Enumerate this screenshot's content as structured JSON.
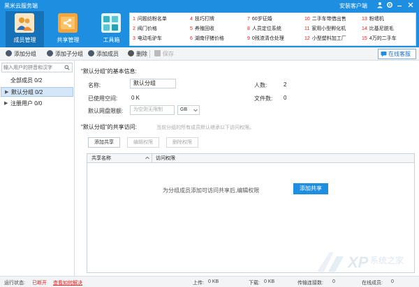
{
  "titlebar": {
    "title": "黑米云服务端",
    "client_label": "安装客户端"
  },
  "nav": [
    {
      "label": "成员管理",
      "icon": "members-icon",
      "color": "#f5b041"
    },
    {
      "label": "共享管理",
      "icon": "share-icon",
      "color": "#f39c34"
    },
    {
      "label": "工具箱",
      "icon": "toolbox-icon",
      "color": "#3cb7c6"
    }
  ],
  "promo": [
    {
      "n": "1",
      "text": "问题纺粉名单"
    },
    {
      "n": "2",
      "text": "阀门价格"
    },
    {
      "n": "3",
      "text": "电动毛驴车"
    },
    {
      "n": "4",
      "text": "技巧打牌"
    },
    {
      "n": "5",
      "text": "养殖回收"
    },
    {
      "n": "6",
      "text": "湖南仔猪价格"
    },
    {
      "n": "7",
      "text": "60岁征婚"
    },
    {
      "n": "8",
      "text": "人员定位系统"
    },
    {
      "n": "9",
      "text": "0残渣清仓处理"
    },
    {
      "n": "10",
      "text": "二手车带借出售"
    },
    {
      "n": "11",
      "text": "家用小型孵化机"
    },
    {
      "n": "12",
      "text": "小型塑料加工厂"
    },
    {
      "n": "13",
      "text": "粉墙机"
    },
    {
      "n": "14",
      "text": "比基尼脱毛"
    },
    {
      "n": "15",
      "text": "4万的二手车"
    }
  ],
  "toolbar": {
    "add_group": "添加分组",
    "add_subgroup": "添加子分组",
    "add_member": "添加成员",
    "delete": "删除",
    "save": "保存",
    "online_service": "在线客服"
  },
  "sidebar": {
    "search_placeholder": "输入用户的拼音和汉字",
    "items": [
      {
        "label": "全部成员 0/2"
      },
      {
        "label": "默认分组 0/2"
      },
      {
        "label": "注册用户 0/0"
      }
    ]
  },
  "main": {
    "basic_title": "\"默认分组\"的基本信息:",
    "name_label": "名称:",
    "name_value": "默认分组",
    "people_label": "人数:",
    "people_value": "2",
    "used_label": "已使用空间:",
    "used_value": "0 K",
    "files_label": "文件数:",
    "files_value": "0",
    "quota_label": "默认网盘限额:",
    "quota_placeholder": "为空则无限制",
    "quota_unit": "GB",
    "share_title": "\"默认分组\"的共享访问:",
    "share_hint": "当前分组的所有成员默认继承以下访问权限。",
    "add_share": "添加共享",
    "edit_perm": "编辑权限",
    "delete_perm": "删除权限",
    "col_share_name": "共享名称",
    "col_access": "访问权限",
    "empty_text": "为分组成员添加可访问共享后,编辑权限",
    "add_share_big": "添加共享"
  },
  "status": {
    "run_label": "运行状态:",
    "run_value": "已断开",
    "fix_link": "查看如何解决",
    "upload_label": "上传:",
    "upload_value": "0 KB",
    "download_label": "下载:",
    "download_value": "0 KB",
    "conn_label": "传输连接数:",
    "conn_value": "0",
    "online_label": "在线成员:",
    "online_value": "0"
  },
  "watermark": {
    "text": "系统之家"
  }
}
